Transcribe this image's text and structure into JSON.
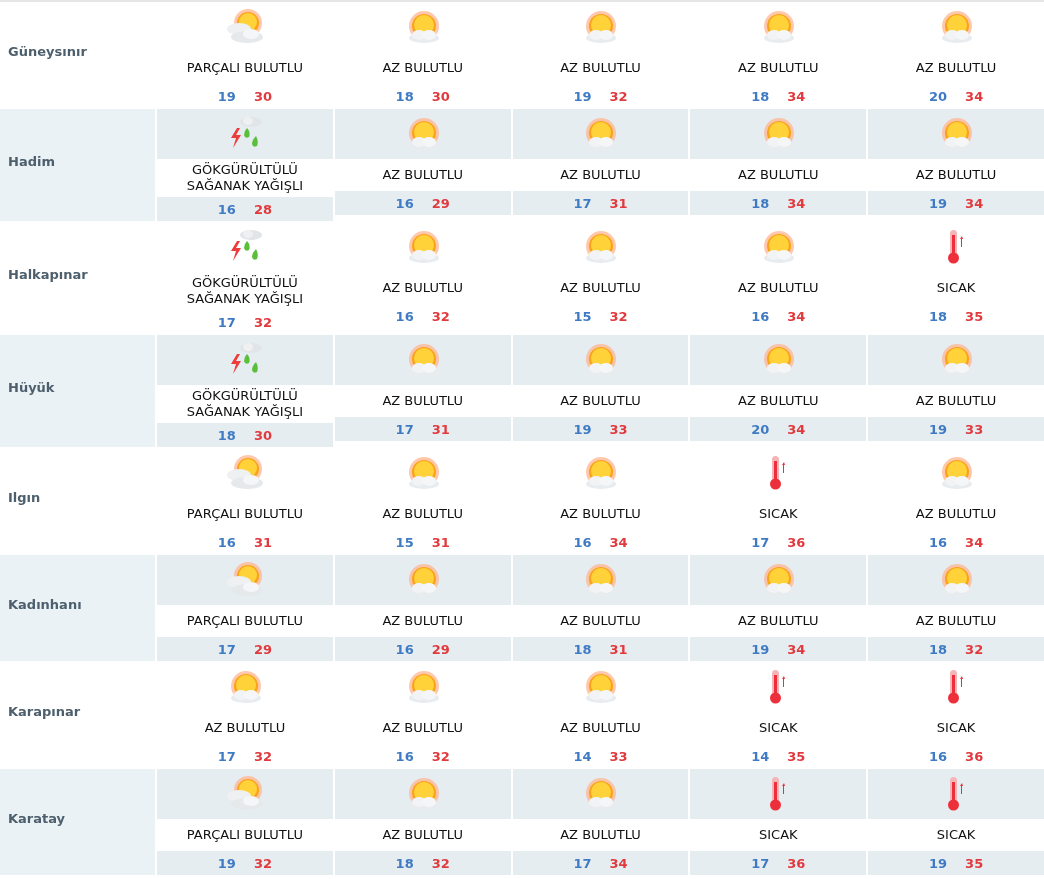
{
  "locations": [
    {
      "name": "Güneysınır",
      "days": [
        {
          "kind": "partly",
          "condition": "PARÇALI BULUTLU",
          "low": "19",
          "high": "30"
        },
        {
          "kind": "sunny",
          "condition": "AZ BULUTLU",
          "low": "18",
          "high": "30"
        },
        {
          "kind": "sunny",
          "condition": "AZ BULUTLU",
          "low": "19",
          "high": "32"
        },
        {
          "kind": "sunny",
          "condition": "AZ BULUTLU",
          "low": "18",
          "high": "34"
        },
        {
          "kind": "sunny",
          "condition": "AZ BULUTLU",
          "low": "20",
          "high": "34"
        }
      ]
    },
    {
      "name": "Hadim",
      "days": [
        {
          "kind": "storm",
          "condition": "GÖKGÜRÜLTÜLÜ SAĞANAK YAĞIŞLI",
          "low": "16",
          "high": "28"
        },
        {
          "kind": "sunny",
          "condition": "AZ BULUTLU",
          "low": "16",
          "high": "29"
        },
        {
          "kind": "sunny",
          "condition": "AZ BULUTLU",
          "low": "17",
          "high": "31"
        },
        {
          "kind": "sunny",
          "condition": "AZ BULUTLU",
          "low": "18",
          "high": "34"
        },
        {
          "kind": "sunny",
          "condition": "AZ BULUTLU",
          "low": "19",
          "high": "34"
        }
      ]
    },
    {
      "name": "Halkapınar",
      "days": [
        {
          "kind": "storm",
          "condition": "GÖKGÜRÜLTÜLÜ SAĞANAK YAĞIŞLI",
          "low": "17",
          "high": "32"
        },
        {
          "kind": "sunny",
          "condition": "AZ BULUTLU",
          "low": "16",
          "high": "32"
        },
        {
          "kind": "sunny",
          "condition": "AZ BULUTLU",
          "low": "15",
          "high": "32"
        },
        {
          "kind": "sunny",
          "condition": "AZ BULUTLU",
          "low": "16",
          "high": "34"
        },
        {
          "kind": "hot",
          "condition": "SICAK",
          "low": "18",
          "high": "35"
        }
      ]
    },
    {
      "name": "Hüyük",
      "days": [
        {
          "kind": "storm",
          "condition": "GÖKGÜRÜLTÜLÜ SAĞANAK YAĞIŞLI",
          "low": "18",
          "high": "30"
        },
        {
          "kind": "sunny",
          "condition": "AZ BULUTLU",
          "low": "17",
          "high": "31"
        },
        {
          "kind": "sunny",
          "condition": "AZ BULUTLU",
          "low": "19",
          "high": "33"
        },
        {
          "kind": "sunny",
          "condition": "AZ BULUTLU",
          "low": "20",
          "high": "34"
        },
        {
          "kind": "sunny",
          "condition": "AZ BULUTLU",
          "low": "19",
          "high": "33"
        }
      ]
    },
    {
      "name": "Ilgın",
      "days": [
        {
          "kind": "partly",
          "condition": "PARÇALI BULUTLU",
          "low": "16",
          "high": "31"
        },
        {
          "kind": "sunny",
          "condition": "AZ BULUTLU",
          "low": "15",
          "high": "31"
        },
        {
          "kind": "sunny",
          "condition": "AZ BULUTLU",
          "low": "16",
          "high": "34"
        },
        {
          "kind": "hot",
          "condition": "SICAK",
          "low": "17",
          "high": "36"
        },
        {
          "kind": "sunny",
          "condition": "AZ BULUTLU",
          "low": "16",
          "high": "34"
        }
      ]
    },
    {
      "name": "Kadınhanı",
      "days": [
        {
          "kind": "partly",
          "condition": "PARÇALI BULUTLU",
          "low": "17",
          "high": "29"
        },
        {
          "kind": "sunny",
          "condition": "AZ BULUTLU",
          "low": "16",
          "high": "29"
        },
        {
          "kind": "sunny",
          "condition": "AZ BULUTLU",
          "low": "18",
          "high": "31"
        },
        {
          "kind": "sunny",
          "condition": "AZ BULUTLU",
          "low": "19",
          "high": "34"
        },
        {
          "kind": "sunny",
          "condition": "AZ BULUTLU",
          "low": "18",
          "high": "32"
        }
      ]
    },
    {
      "name": "Karapınar",
      "days": [
        {
          "kind": "sunny",
          "condition": "AZ BULUTLU",
          "low": "17",
          "high": "32"
        },
        {
          "kind": "sunny",
          "condition": "AZ BULUTLU",
          "low": "16",
          "high": "32"
        },
        {
          "kind": "sunny",
          "condition": "AZ BULUTLU",
          "low": "14",
          "high": "33"
        },
        {
          "kind": "hot",
          "condition": "SICAK",
          "low": "14",
          "high": "35"
        },
        {
          "kind": "hot",
          "condition": "SICAK",
          "low": "16",
          "high": "36"
        }
      ]
    },
    {
      "name": "Karatay",
      "days": [
        {
          "kind": "partly",
          "condition": "PARÇALI BULUTLU",
          "low": "19",
          "high": "32"
        },
        {
          "kind": "sunny",
          "condition": "AZ BULUTLU",
          "low": "18",
          "high": "32"
        },
        {
          "kind": "sunny",
          "condition": "AZ BULUTLU",
          "low": "17",
          "high": "34"
        },
        {
          "kind": "hot",
          "condition": "SICAK",
          "low": "17",
          "high": "36"
        },
        {
          "kind": "hot",
          "condition": "SICAK",
          "low": "19",
          "high": "35"
        }
      ]
    }
  ]
}
